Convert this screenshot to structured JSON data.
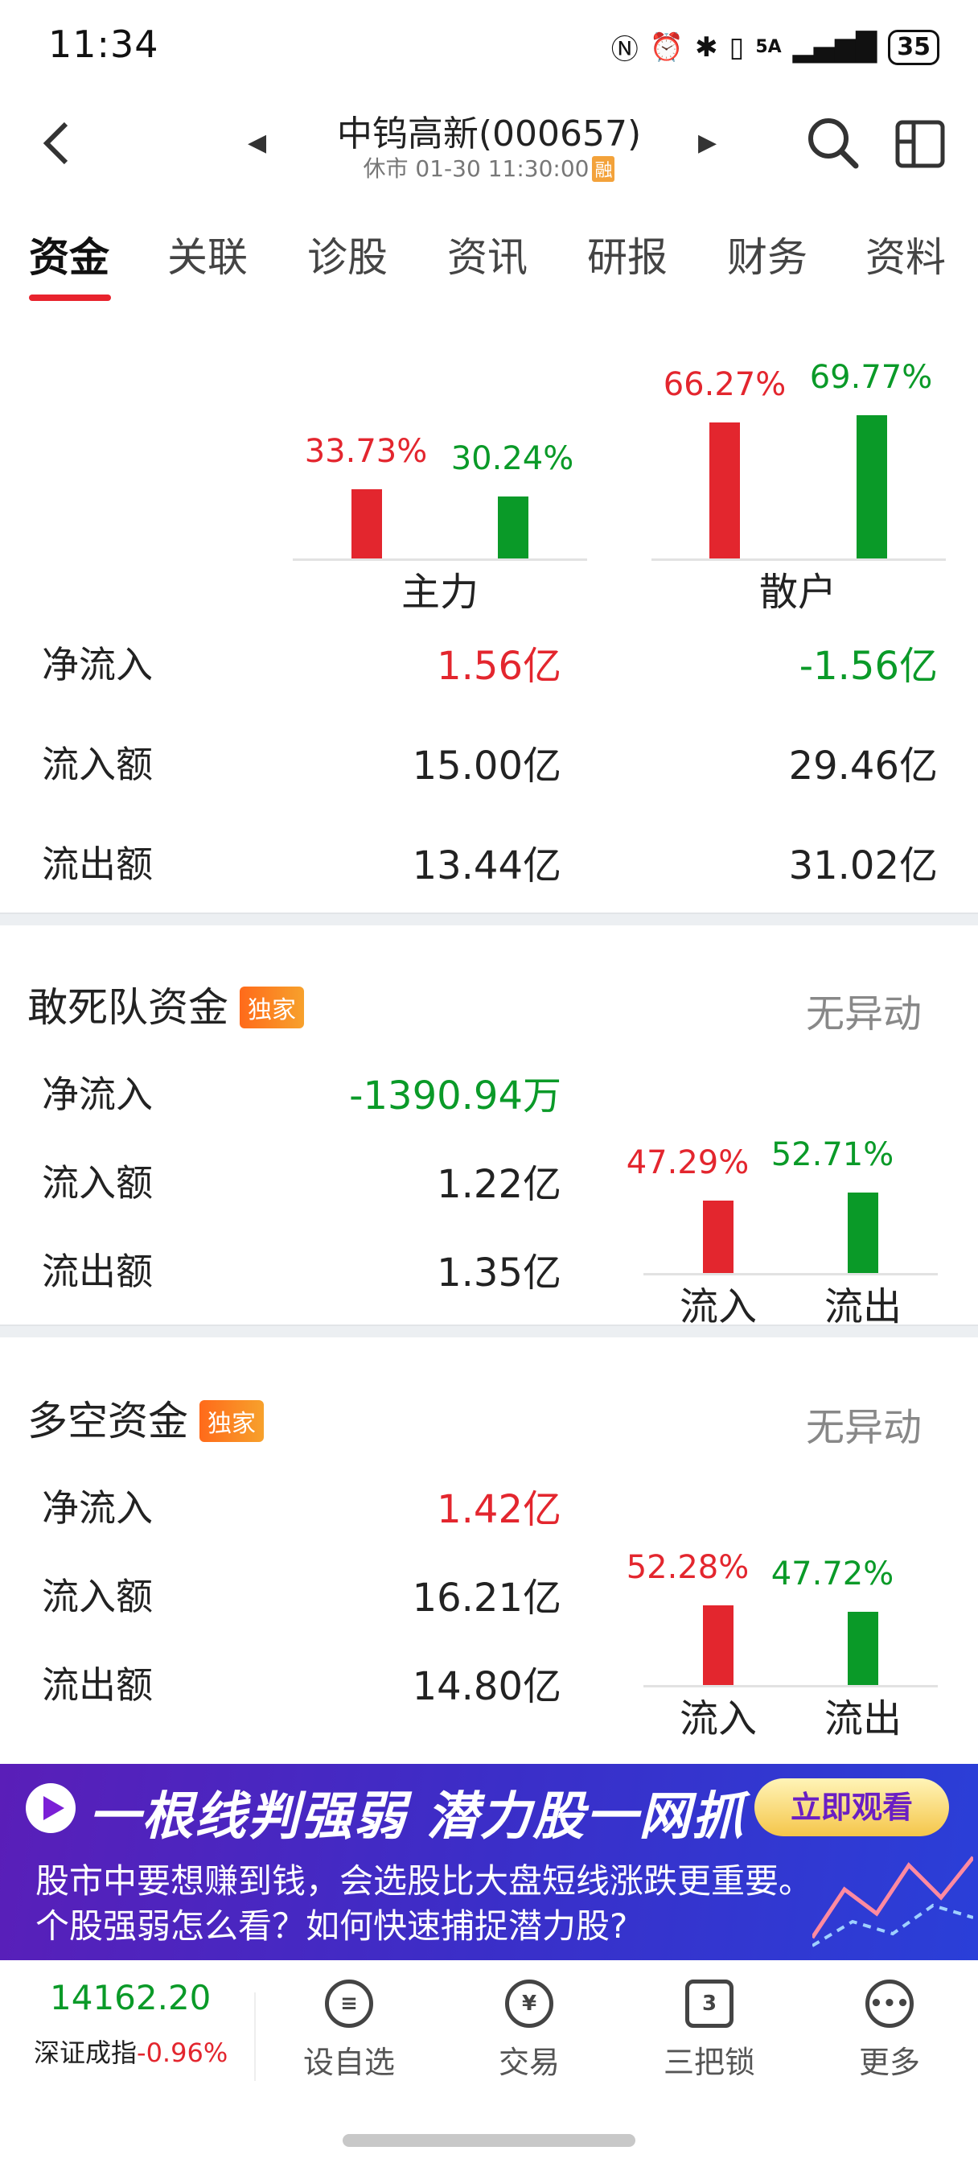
{
  "status_bar": {
    "time": "11:34",
    "battery": "35",
    "signal_label": "5A"
  },
  "header": {
    "title": "中钨高新(000657)",
    "subtitle": "休市 01-30 11:30:00",
    "badge": "融"
  },
  "tabs": [
    "资金",
    "关联",
    "诊股",
    "资讯",
    "研报",
    "财务",
    "资料"
  ],
  "main_section": {
    "groups": [
      {
        "name": "主力",
        "inflow_pct_label": "33.73%",
        "outflow_pct_label": "30.24%",
        "inflow_pct": 33.73,
        "outflow_pct": 30.24
      },
      {
        "name": "散户",
        "inflow_pct_label": "66.27%",
        "outflow_pct_label": "69.77%",
        "inflow_pct": 66.27,
        "outflow_pct": 69.77
      }
    ],
    "rows": [
      {
        "label": "净流入",
        "main": "1.56亿",
        "retail": "-1.56亿"
      },
      {
        "label": "流入额",
        "main": "15.00亿",
        "retail": "29.46亿"
      },
      {
        "label": "流出额",
        "main": "13.44亿",
        "retail": "31.02亿"
      }
    ]
  },
  "dare_section": {
    "title": "敢死队资金",
    "badge": "独家",
    "status": "无异动",
    "rows": [
      {
        "label": "净流入",
        "value": "-1390.94万"
      },
      {
        "label": "流入额",
        "value": "1.22亿"
      },
      {
        "label": "流出额",
        "value": "1.35亿"
      }
    ],
    "bars": {
      "in_label": "流入",
      "out_label": "流出",
      "in_pct_label": "47.29%",
      "out_pct_label": "52.71%",
      "in_pct": 47.29,
      "out_pct": 52.71
    }
  },
  "longshort_section": {
    "title": "多空资金",
    "badge": "独家",
    "status": "无异动",
    "rows": [
      {
        "label": "净流入",
        "value": "1.42亿"
      },
      {
        "label": "流入额",
        "value": "16.21亿"
      },
      {
        "label": "流出额",
        "value": "14.80亿"
      }
    ],
    "bars": {
      "in_label": "流入",
      "out_label": "流出",
      "in_pct_label": "52.28%",
      "out_pct_label": "47.72%",
      "in_pct": 52.28,
      "out_pct": 47.72
    }
  },
  "banner": {
    "headline": "一根线判强弱  潜力股一网抓",
    "button": "立即观看",
    "line1": "股市中要想赚到钱，会选股比大盘短线涨跌更重要。",
    "line2": "个股强弱怎么看？如何快速捕捉潜力股?"
  },
  "bottom_bar": {
    "index_value": "14162.20",
    "index_name": "深证成指",
    "index_change": "-0.96%",
    "items": [
      {
        "label": "设自选",
        "icon": "list-icon"
      },
      {
        "label": "交易",
        "icon": "yen-icon"
      },
      {
        "label": "三把锁",
        "icon": "lock-icon",
        "icon_text": "3"
      },
      {
        "label": "更多",
        "icon": "more-icon"
      }
    ]
  },
  "colors": {
    "up": "#e3262e",
    "down": "#0a9a28",
    "accent": "#e8232d"
  }
}
